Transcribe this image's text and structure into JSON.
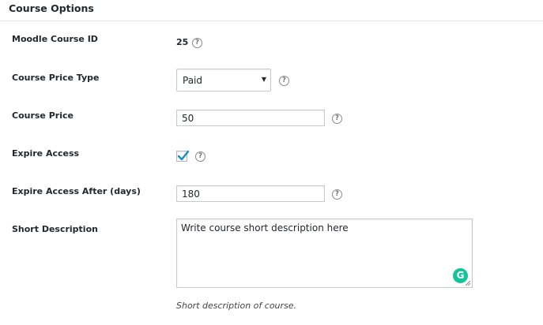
{
  "header": {
    "title": "Course Options"
  },
  "fields": {
    "moodle_course_id": {
      "label": "Moodle Course ID",
      "value": "25",
      "help_icon": "?"
    },
    "course_price_type": {
      "label": "Course Price Type",
      "selected": "Paid",
      "arrow": "▼",
      "help_icon": "?"
    },
    "course_price": {
      "label": "Course Price",
      "value": "50",
      "help_icon": "?"
    },
    "expire_access": {
      "label": "Expire Access",
      "checked": true,
      "help_icon": "?"
    },
    "expire_access_after": {
      "label": "Expire Access After (days)",
      "value": "180",
      "help_icon": "?"
    },
    "short_description": {
      "label": "Short Description",
      "value": "Write course short description here",
      "hint": "Short description of course.",
      "grammarly_badge": "G"
    }
  },
  "colors": {
    "grammarly": "#15c39a",
    "checkmark": "#1e8cbe"
  }
}
